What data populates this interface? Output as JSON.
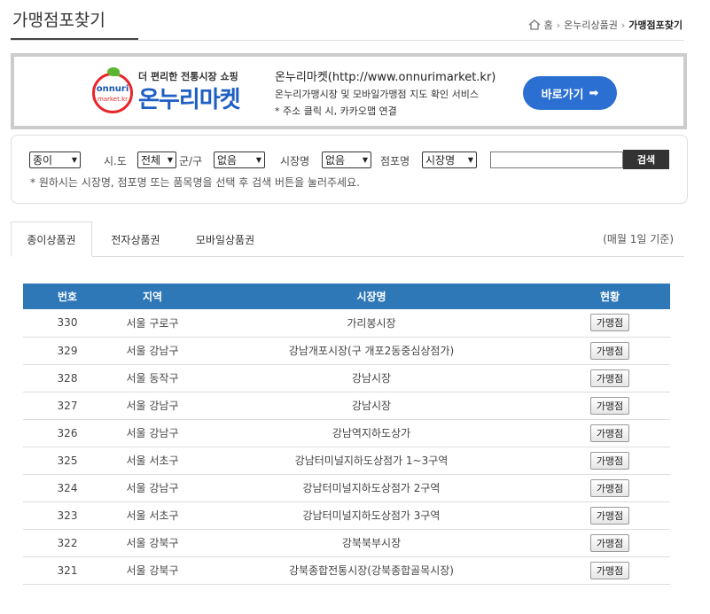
{
  "page_title": "가맹점포찾기",
  "breadcrumb": {
    "home": "홈",
    "level1": "온누리상품권",
    "current": "가맹점포찾기"
  },
  "banner": {
    "logo_tagline": "더 편리한 전통시장 쇼핑",
    "logo_badge_top": "onnuri",
    "logo_badge_bottom": "market.kr",
    "logo_name": "온누리마켓",
    "title": "온누리마켓(http://www.onnurimarket.kr)",
    "description": "온누리가맹시장 및 모바일가맹점 지도 확인 서비스",
    "note": "* 주소 클릭 시, 카카오맵 연결",
    "button_label": "바로가기",
    "button_arrow": "➡"
  },
  "search": {
    "type_value": "종이",
    "sido_label": "시.도",
    "sido_value": "전체",
    "gugun_label": "군/구",
    "gugun_value": "없음",
    "market_label": "시장명",
    "market_value": "없음",
    "store_label": "점포명",
    "store_type_value": "시장명",
    "input_value": "",
    "button_label": "검색",
    "help_text": "* 원하시는 시장명, 점포명 또는 품목명을 선택 후 검색 버튼을 눌러주세요."
  },
  "tabs": [
    {
      "label": "종이상품권",
      "active": true
    },
    {
      "label": "전자상품권",
      "active": false
    },
    {
      "label": "모바일상품권",
      "active": false
    }
  ],
  "tab_note": "(매월 1일 기준)",
  "table": {
    "headers": [
      "번호",
      "지역",
      "시장명",
      "현황"
    ],
    "rows": [
      {
        "no": "330",
        "region": "서울 구로구",
        "market": "가리봉시장",
        "status": "가맹점"
      },
      {
        "no": "329",
        "region": "서울 강남구",
        "market": "강남개포시장(구 개포2동중심상점가)",
        "status": "가맹점"
      },
      {
        "no": "328",
        "region": "서울 동작구",
        "market": "강남시장",
        "status": "가맹점"
      },
      {
        "no": "327",
        "region": "서울 강남구",
        "market": "강남시장",
        "status": "가맹점"
      },
      {
        "no": "326",
        "region": "서울 강남구",
        "market": "강남역지하도상가",
        "status": "가맹점"
      },
      {
        "no": "325",
        "region": "서울 서초구",
        "market": "강남터미널지하도상점가 1~3구역",
        "status": "가맹점"
      },
      {
        "no": "324",
        "region": "서울 강남구",
        "market": "강남터미널지하도상점가 2구역",
        "status": "가맹점"
      },
      {
        "no": "323",
        "region": "서울 서초구",
        "market": "강남터미널지하도상점가 3구역",
        "status": "가맹점"
      },
      {
        "no": "322",
        "region": "서울 강북구",
        "market": "강북북부시장",
        "status": "가맹점"
      },
      {
        "no": "321",
        "region": "서울 강북구",
        "market": "강북종합전통시장(강북종합골목시장)",
        "status": "가맹점"
      }
    ]
  },
  "colors": {
    "header_blue": "#2f78b8",
    "button_blue": "#2a6fd1",
    "logo_red": "#e8262a",
    "logo_blue": "#1f5fc4"
  },
  "icons": {
    "home": "home-icon"
  }
}
